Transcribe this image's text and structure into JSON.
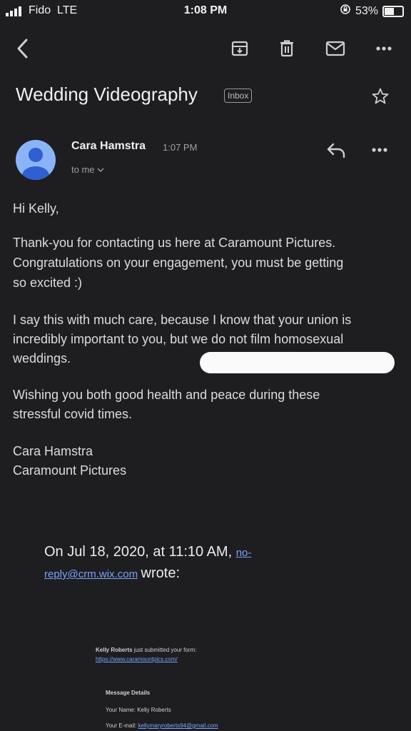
{
  "status_bar": {
    "carrier": "Fido",
    "network": "LTE",
    "time": "1:08 PM",
    "battery": "53%",
    "battery_level": 0.53
  },
  "toolbar": {
    "back_icon": "back-arrow-icon",
    "archive_icon": "archive-icon",
    "delete_icon": "trash-icon",
    "mail_icon": "mail-icon",
    "more_icon": "more-icon"
  },
  "email": {
    "subject": "Wedding Videography",
    "label": "Inbox",
    "sender": "Cara Hamstra",
    "time": "1:07 PM",
    "recipient": "to me",
    "body": {
      "greeting": "Hi Kelly,",
      "p1": [
        "Thank-you for contacting us here at Caramount Pictures.",
        "Congratulations on your engagement, you must be getting",
        "so excited :)"
      ],
      "p2": [
        "I say this with much care, because I know that your union is",
        "incredibly important to you, but we do not film homosexual",
        "weddings."
      ],
      "p3": [
        "Wishing you both good health and peace during these",
        "stressful covid times."
      ],
      "signature": [
        "Cara Hamstra",
        "Caramount Pictures"
      ]
    },
    "quoted": {
      "intro": "On Jul 18, 2020, at 11:10 AM,",
      "email_part1": "no-",
      "email_part2": "reply@crm.wix.com",
      "wrote": "wrote:",
      "form_submitter": "Kelly Roberts",
      "form_submit_text": "just submitted your form:",
      "form_url": "https://www.caramountpics.com/",
      "details_title": "Message Details",
      "name_label": "Your Name:",
      "name_value": "Kelly Roberts",
      "email_label": "Your E-mail:",
      "email_value": "kellymaryroberts94@gmail.com"
    }
  },
  "colors": {
    "background": "#1e1e20",
    "link": "#7aa2ff",
    "avatar": "#8ab4f8"
  }
}
